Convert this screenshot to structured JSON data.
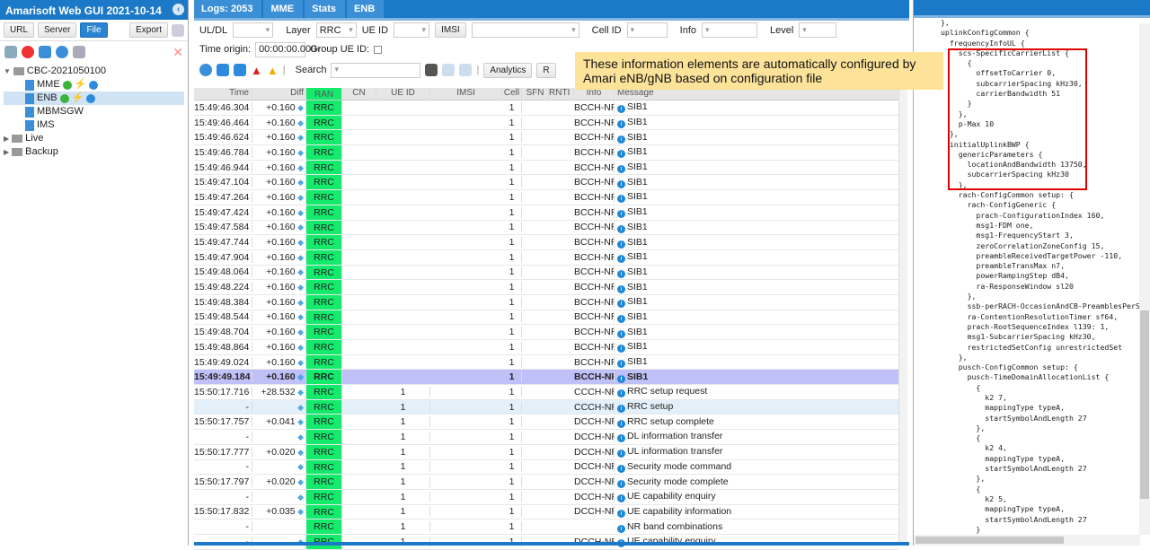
{
  "app": {
    "title": "Amarisoft Web GUI 2021-10-14"
  },
  "left": {
    "buttons": {
      "url": "URL",
      "server": "Server",
      "file": "File",
      "export": "Export"
    },
    "tree": [
      {
        "label": "CBC-2021050100",
        "type": "folder"
      },
      {
        "label": "MME",
        "type": "server"
      },
      {
        "label": "ENB",
        "type": "server",
        "selected": true
      },
      {
        "label": "MBMSGW",
        "type": "server"
      },
      {
        "label": "IMS",
        "type": "server"
      },
      {
        "label": "Live",
        "type": "folder"
      },
      {
        "label": "Backup",
        "type": "folder"
      }
    ]
  },
  "tabs": [
    {
      "label": "Logs: 2053"
    },
    {
      "label": "MME"
    },
    {
      "label": "Stats"
    },
    {
      "label": "ENB"
    }
  ],
  "filters": {
    "uldl_label": "UL/DL",
    "uldl_value": "",
    "layer_label": "Layer",
    "layer_value": "RRC",
    "ueid_label": "UE ID",
    "ueid_value": "",
    "imsi_label": "IMSI",
    "imsi_value": "",
    "cellid_label": "Cell ID",
    "info_label": "Info",
    "level_label": "Level",
    "time_origin_label": "Time origin:",
    "time_origin_value": "00:00:00.000",
    "group_ueid_label": "Group UE ID:",
    "search_label": "Search",
    "search_value": "",
    "analytics_label": "Analytics",
    "r_label": "R"
  },
  "table": {
    "columns": [
      "Time",
      "Diff",
      "RAN",
      "CN",
      "UE ID",
      "IMSI",
      "Cell",
      "SFN",
      "RNTI",
      "Info",
      "Message"
    ],
    "rows": [
      [
        "15:49:46.304",
        "+0.160",
        "RRC",
        "",
        "",
        "",
        "1",
        "",
        "",
        "BCCH-NR",
        "SIB1"
      ],
      [
        "15:49:46.464",
        "+0.160",
        "RRC",
        "",
        "",
        "",
        "1",
        "",
        "",
        "BCCH-NR",
        "SIB1"
      ],
      [
        "15:49:46.624",
        "+0.160",
        "RRC",
        "",
        "",
        "",
        "1",
        "",
        "",
        "BCCH-NR",
        "SIB1"
      ],
      [
        "15:49:46.784",
        "+0.160",
        "RRC",
        "",
        "",
        "",
        "1",
        "",
        "",
        "BCCH-NR",
        "SIB1"
      ],
      [
        "15:49:46.944",
        "+0.160",
        "RRC",
        "",
        "",
        "",
        "1",
        "",
        "",
        "BCCH-NR",
        "SIB1"
      ],
      [
        "15:49:47.104",
        "+0.160",
        "RRC",
        "",
        "",
        "",
        "1",
        "",
        "",
        "BCCH-NR",
        "SIB1"
      ],
      [
        "15:49:47.264",
        "+0.160",
        "RRC",
        "",
        "",
        "",
        "1",
        "",
        "",
        "BCCH-NR",
        "SIB1"
      ],
      [
        "15:49:47.424",
        "+0.160",
        "RRC",
        "",
        "",
        "",
        "1",
        "",
        "",
        "BCCH-NR",
        "SIB1"
      ],
      [
        "15:49:47.584",
        "+0.160",
        "RRC",
        "",
        "",
        "",
        "1",
        "",
        "",
        "BCCH-NR",
        "SIB1"
      ],
      [
        "15:49:47.744",
        "+0.160",
        "RRC",
        "",
        "",
        "",
        "1",
        "",
        "",
        "BCCH-NR",
        "SIB1"
      ],
      [
        "15:49:47.904",
        "+0.160",
        "RRC",
        "",
        "",
        "",
        "1",
        "",
        "",
        "BCCH-NR",
        "SIB1"
      ],
      [
        "15:49:48.064",
        "+0.160",
        "RRC",
        "",
        "",
        "",
        "1",
        "",
        "",
        "BCCH-NR",
        "SIB1"
      ],
      [
        "15:49:48.224",
        "+0.160",
        "RRC",
        "",
        "",
        "",
        "1",
        "",
        "",
        "BCCH-NR",
        "SIB1"
      ],
      [
        "15:49:48.384",
        "+0.160",
        "RRC",
        "",
        "",
        "",
        "1",
        "",
        "",
        "BCCH-NR",
        "SIB1"
      ],
      [
        "15:49:48.544",
        "+0.160",
        "RRC",
        "",
        "",
        "",
        "1",
        "",
        "",
        "BCCH-NR",
        "SIB1"
      ],
      [
        "15:49:48.704",
        "+0.160",
        "RRC",
        "",
        "",
        "",
        "1",
        "",
        "",
        "BCCH-NR",
        "SIB1"
      ],
      [
        "15:49:48.864",
        "+0.160",
        "RRC",
        "",
        "",
        "",
        "1",
        "",
        "",
        "BCCH-NR",
        "SIB1"
      ],
      [
        "15:49:49.024",
        "+0.160",
        "RRC",
        "",
        "",
        "",
        "1",
        "",
        "",
        "BCCH-NR",
        "SIB1"
      ],
      [
        "15:49:49.184",
        "+0.160",
        "RRC",
        "",
        "",
        "",
        "1",
        "",
        "",
        "BCCH-NR",
        "SIB1"
      ],
      [
        "15:50:17.716",
        "+28.532",
        "RRC",
        "",
        "1",
        "",
        "1",
        "",
        "",
        "CCCH-NR",
        "RRC setup request"
      ],
      [
        "-",
        "",
        "RRC",
        "",
        "1",
        "",
        "1",
        "",
        "",
        "CCCH-NR",
        "RRC setup"
      ],
      [
        "15:50:17.757",
        "+0.041",
        "RRC",
        "",
        "1",
        "",
        "1",
        "",
        "",
        "DCCH-NR",
        "RRC setup complete"
      ],
      [
        "-",
        "",
        "RRC",
        "",
        "1",
        "",
        "1",
        "",
        "",
        "DCCH-NR",
        "DL information transfer"
      ],
      [
        "15:50:17.777",
        "+0.020",
        "RRC",
        "",
        "1",
        "",
        "1",
        "",
        "",
        "DCCH-NR",
        "UL information transfer"
      ],
      [
        "-",
        "",
        "RRC",
        "",
        "1",
        "",
        "1",
        "",
        "",
        "DCCH-NR",
        "Security mode command"
      ],
      [
        "15:50:17.797",
        "+0.020",
        "RRC",
        "",
        "1",
        "",
        "1",
        "",
        "",
        "DCCH-NR",
        "Security mode complete"
      ],
      [
        "-",
        "",
        "RRC",
        "",
        "1",
        "",
        "1",
        "",
        "",
        "DCCH-NR",
        "UE capability enquiry"
      ],
      [
        "15:50:17.832",
        "+0.035",
        "RRC",
        "",
        "1",
        "",
        "1",
        "",
        "",
        "DCCH-NR",
        "UE capability information"
      ],
      [
        "-",
        "",
        "RRC",
        "",
        "1",
        "",
        "1",
        "",
        "",
        "",
        "NR band combinations"
      ],
      [
        "-",
        "",
        "RRC",
        "",
        "1",
        "",
        "1",
        "",
        "",
        "DCCH-NR",
        "UE capability enquiry"
      ]
    ],
    "highlighted_row": 18,
    "selected_row": 20
  },
  "note": {
    "text": "These information elements are automatically configured by Amari eNB/gNB based on configuration file"
  },
  "code": {
    "lines": [
      "},",
      "uplinkConfigCommon {",
      "  frequencyInfoUL {",
      "    scs-SpecificCarrierList {",
      "      {",
      "        offsetToCarrier 0,",
      "        subcarrierSpacing kHz30,",
      "        carrierBandwidth 51",
      "      }",
      "    },",
      "    p-Max 10",
      "  },",
      "  initialUplinkBWP {",
      "    genericParameters {",
      "      locationAndBandwidth 13750,",
      "      subcarrierSpacing kHz30",
      "    },",
      "    rach-ConfigCommon setup: {",
      "      rach-ConfigGeneric {",
      "        prach-ConfigurationIndex 160,",
      "        msg1-FDM one,",
      "        msg1-FrequencyStart 3,",
      "        zeroCorrelationZoneConfig 15,",
      "        preambleReceivedTargetPower -110,",
      "        preambleTransMax n7,",
      "        powerRampingStep dB4,",
      "        ra-ResponseWindow sl20",
      "      },",
      "      ssb-perRACH-OccasionAndCB-PreamblesPerSSB",
      "      ra-ContentionResolutionTimer sf64,",
      "      prach-RootSequenceIndex l139: 1,",
      "      msg1-SubcarrierSpacing kHz30,",
      "      restrictedSetConfig unrestrictedSet",
      "    },",
      "    pusch-ConfigCommon setup: {",
      "      pusch-TimeDomainAllocationList {",
      "        {",
      "          k2 7,",
      "          mappingType typeA,",
      "          startSymbolAndLength 27",
      "        },",
      "        {",
      "          k2 4,",
      "          mappingType typeA,",
      "          startSymbolAndLength 27",
      "        },",
      "        {",
      "          k2 5,",
      "          mappingType typeA,",
      "          startSymbolAndLength 27",
      "        }"
    ]
  },
  "colors": {
    "accent": "#1b79c7",
    "ran_rrc": "#14ea6c",
    "highlight_row": "#c0c0f8",
    "note_bg": "#fde39a",
    "red_box": "#e00000"
  }
}
